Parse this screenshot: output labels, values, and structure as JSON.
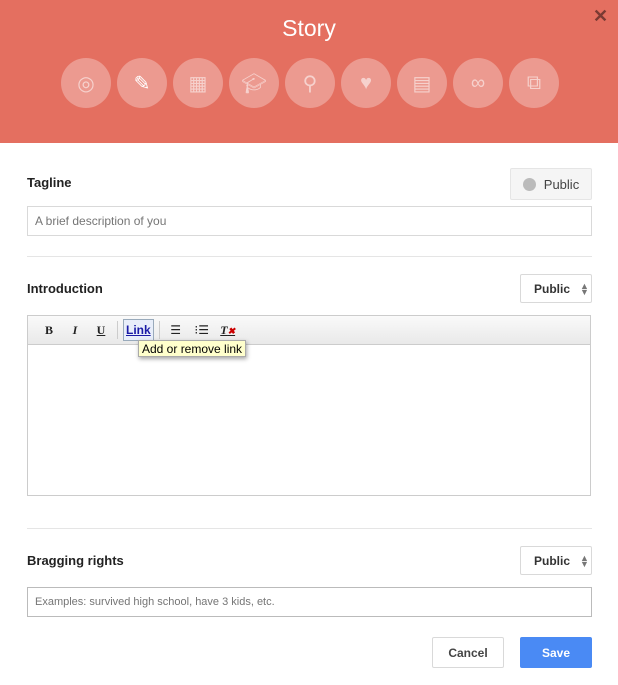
{
  "dialog": {
    "title": "Story",
    "close_icon": "close-icon"
  },
  "header_icons": [
    "circles-icon",
    "pencil-icon",
    "building-icon",
    "graduation-cap-icon",
    "map-pin-icon",
    "interests-icon",
    "contact-card-icon",
    "link-icon",
    "external-icon"
  ],
  "header_color": "#e46f60",
  "tagline": {
    "label": "Tagline",
    "visibility": "Public",
    "placeholder": "A brief description of you"
  },
  "introduction": {
    "label": "Introduction",
    "visibility": "Public",
    "toolbar": {
      "bold": "B",
      "italic": "I",
      "underline": "U",
      "link": "Link",
      "numbered_list": "numbered-list-icon",
      "bulleted_list": "bulleted-list-icon",
      "clear_format": "clear-formatting-icon"
    },
    "tooltip": "Add or remove link"
  },
  "bragging_rights": {
    "label": "Bragging rights",
    "visibility": "Public",
    "placeholder": "Examples: survived high school, have 3 kids, etc."
  },
  "footer": {
    "cancel": "Cancel",
    "save": "Save",
    "save_color": "#4a8af4"
  }
}
